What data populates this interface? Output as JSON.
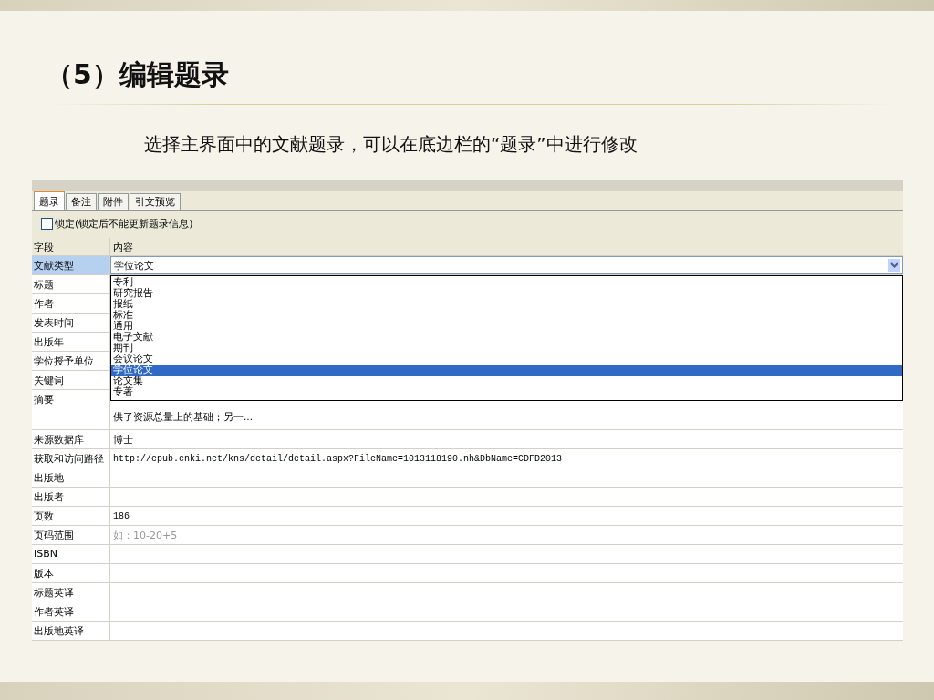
{
  "slide": {
    "title": "（5）编辑题录",
    "subtitle": "选择主界面中的文献题录，可以在底边栏的“题录”中进行修改"
  },
  "panel": {
    "tabs": [
      {
        "label": "题录",
        "selected": true
      },
      {
        "label": "备注",
        "selected": false
      },
      {
        "label": "附件",
        "selected": false
      },
      {
        "label": "引文预览",
        "selected": false
      }
    ],
    "lock": {
      "label": "锁定(锁定后不能更新题录信息)",
      "checked": false
    },
    "columns": [
      "字段",
      "内容"
    ],
    "rows": [
      {
        "field": "文献类型",
        "kind": "select",
        "value": "学位论文",
        "selected": true
      },
      {
        "field": "标题",
        "kind": "text",
        "selected": false
      },
      {
        "field": "作者",
        "kind": "text",
        "selected": false
      },
      {
        "field": "发表时间",
        "kind": "text",
        "selected": false
      },
      {
        "field": "出版年",
        "kind": "text",
        "selected": false
      },
      {
        "field": "学位授予单位",
        "kind": "text",
        "selected": false
      },
      {
        "field": "关键词",
        "kind": "text",
        "selected": false
      },
      {
        "field": "摘要",
        "kind": "multiline",
        "lines": [
          "供了资源总量上的基础；另一..."
        ],
        "selected": false
      },
      {
        "field": "来源数据库",
        "kind": "text",
        "value": "博士",
        "selected": false
      },
      {
        "field": "获取和访问路径",
        "kind": "mono",
        "value": "http://epub.cnki.net/kns/detail/detail.aspx?FileName=1013118190.nh&DbName=CDFD2013",
        "selected": false
      },
      {
        "field": "出版地",
        "kind": "text",
        "selected": false
      },
      {
        "field": "出版者",
        "kind": "text",
        "selected": false
      },
      {
        "field": "页数",
        "kind": "mono",
        "value": "186",
        "selected": false
      },
      {
        "field": "页码范围",
        "kind": "text",
        "placeholder": "如：10-20+5",
        "selected": false
      },
      {
        "field": "ISBN",
        "kind": "mono",
        "selected": false
      },
      {
        "field": "版本",
        "kind": "text",
        "selected": false
      },
      {
        "field": "标题英译",
        "kind": "text",
        "selected": false
      },
      {
        "field": "作者英译",
        "kind": "text",
        "selected": false
      },
      {
        "field": "出版地英译",
        "kind": "text",
        "selected": false
      }
    ],
    "dropdown": {
      "options": [
        {
          "label": "专利",
          "selected": false
        },
        {
          "label": "研究报告",
          "selected": false
        },
        {
          "label": "报纸",
          "selected": false
        },
        {
          "label": "标准",
          "selected": false
        },
        {
          "label": "通用",
          "selected": false
        },
        {
          "label": "电子文献",
          "selected": false
        },
        {
          "label": "期刊",
          "selected": false
        },
        {
          "label": "会议论文",
          "selected": false
        },
        {
          "label": "学位论文",
          "selected": true
        },
        {
          "label": "论文集",
          "selected": false
        },
        {
          "label": "专著",
          "selected": false
        }
      ]
    }
  }
}
